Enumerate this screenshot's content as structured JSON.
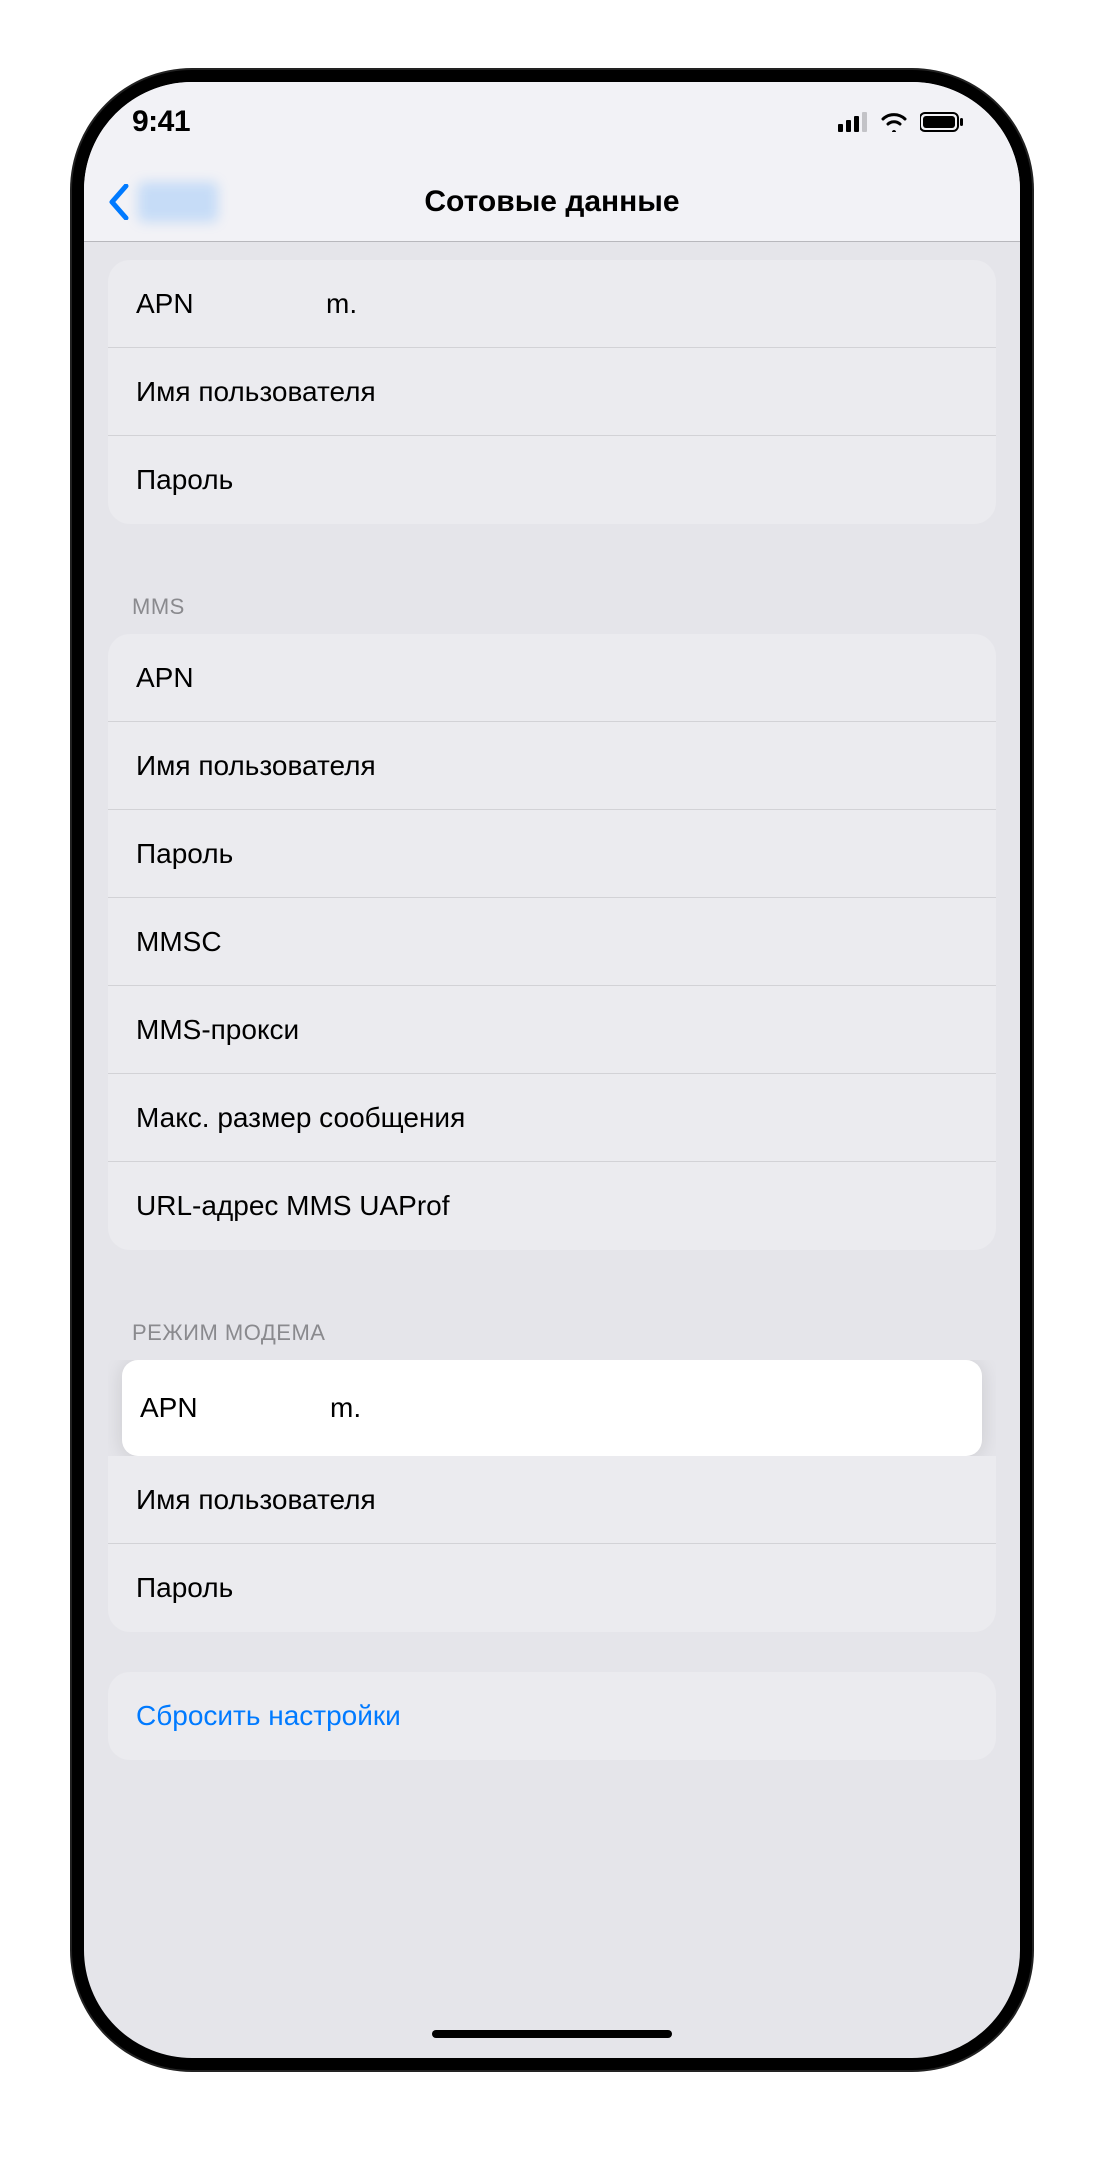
{
  "status": {
    "time": "9:41"
  },
  "nav": {
    "title": "Сотовые данные"
  },
  "groups": {
    "cellular": {
      "apn_label": "APN",
      "apn_value": "m.",
      "user_label": "Имя пользователя",
      "pass_label": "Пароль"
    },
    "mms": {
      "header": "MMS",
      "apn_label": "APN",
      "user_label": "Имя пользователя",
      "pass_label": "Пароль",
      "mmsc_label": "MMSC",
      "proxy_label": "MMS-прокси",
      "max_label": "Макс. размер сообщения",
      "uaprof_label": "URL-адрес MMS UAProf"
    },
    "hotspot": {
      "header": "РЕЖИМ МОДЕМА",
      "apn_label": "APN",
      "apn_value": "m.",
      "user_label": "Имя пользователя",
      "pass_label": "Пароль"
    }
  },
  "reset": {
    "label": "Сбросить настройки"
  }
}
